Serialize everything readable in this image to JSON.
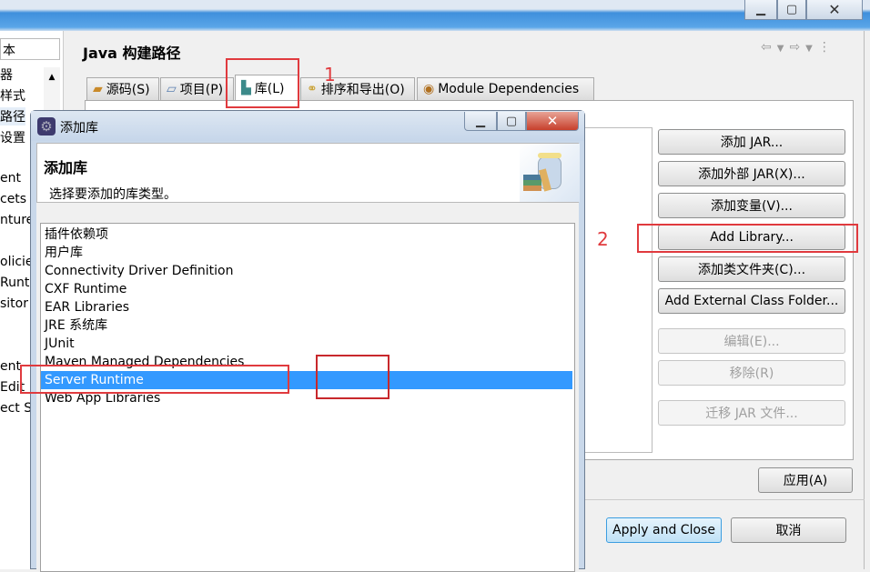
{
  "window": {
    "controls": [
      "minimize",
      "maximize",
      "close"
    ]
  },
  "sidebar": {
    "filter_value": "本",
    "items": [
      "器",
      "样式",
      "路径",
      "设置",
      "ent",
      "cets",
      "nture",
      "olicie",
      "Runt",
      "sitor",
      "ent",
      "Edit",
      "ect Se"
    ]
  },
  "page": {
    "title": "Java 构建路径"
  },
  "tabs": [
    {
      "label": "源码(S)",
      "icon": "source-folder-icon"
    },
    {
      "label": "项目(P)",
      "icon": "project-folder-icon"
    },
    {
      "label": "库(L)",
      "icon": "library-icon",
      "selected": true
    },
    {
      "label": "排序和导出(O)",
      "icon": "order-export-icon"
    },
    {
      "label": "Module Dependencies",
      "icon": "module-icon"
    }
  ],
  "buttons": {
    "add_jar": "添加 JAR...",
    "add_external_jar": "添加外部 JAR(X)...",
    "add_variable": "添加变量(V)...",
    "add_library": "Add Library...",
    "add_class_folder": "添加类文件夹(C)...",
    "add_external_class_folder": "Add External Class Folder...",
    "edit": "编辑(E)...",
    "remove": "移除(R)",
    "migrate_jar": "迁移 JAR 文件...",
    "apply": "应用(A)",
    "apply_and_close": "Apply and Close",
    "cancel": "取消"
  },
  "annotations": {
    "step1": "1",
    "step2": "2",
    "color": "#e03a3e"
  },
  "dialog": {
    "window_title": "添加库",
    "header_title": "添加库",
    "header_subtitle": "选择要添加的库类型。",
    "items": [
      "插件依赖项",
      "用户库",
      "Connectivity Driver Definition",
      "CXF Runtime",
      "EAR Libraries",
      "JRE 系统库",
      "JUnit",
      "Maven Managed Dependencies",
      "Server Runtime",
      "Web App Libraries"
    ],
    "selected_index": 8,
    "selection_color": "#3399ff"
  }
}
